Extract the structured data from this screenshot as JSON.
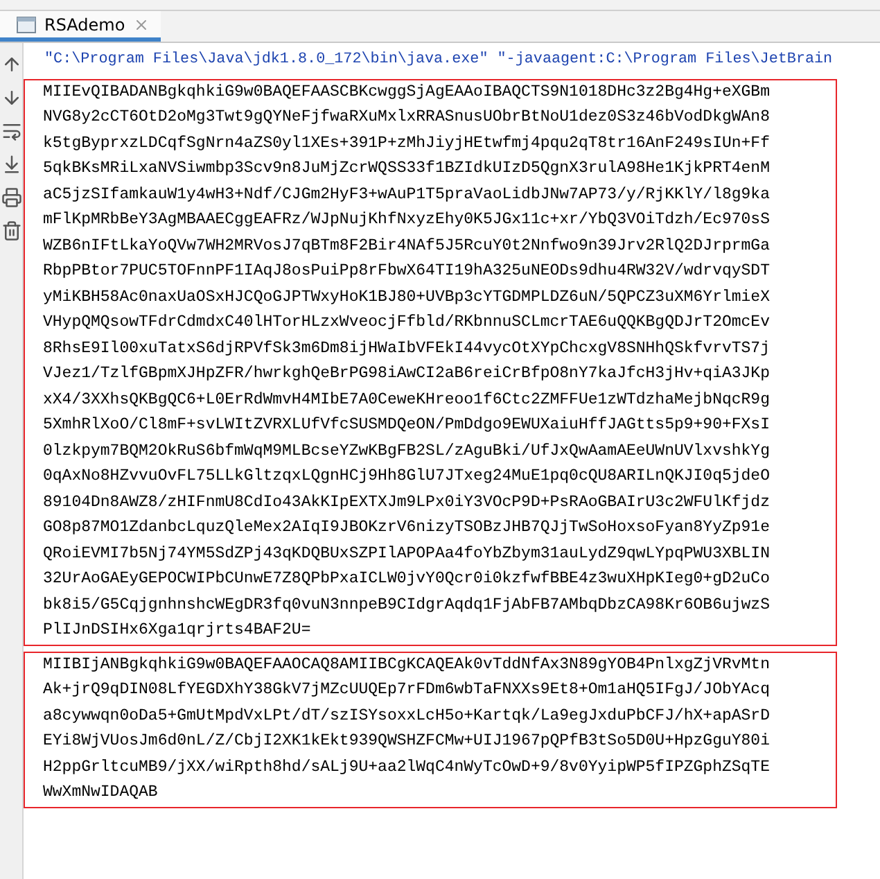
{
  "run_tab": {
    "title": "RSAdemo",
    "selected": true
  },
  "command_line": "\"C:\\Program Files\\Java\\jdk1.8.0_172\\bin\\java.exe\" \"-javaagent:C:\\Program Files\\JetBrain",
  "output_blocks": [
    {
      "lines": [
        "MIIEvQIBADANBgkqhkiG9w0BAQEFAASCBKcwggSjAgEAAoIBAQCTS9N1018DHc3z2Bg4Hg+eXGBm",
        "NVG8y2cCT6OtD2oMg3Twt9gQYNeFjfwaRXuMxlxRRASnusUObrBtNoU1dez0S3z46bVodDkgWAn8",
        "k5tgByprxzLDCqfSgNrn4aZS0yl1XEs+391P+zMhJiyjHEtwfmj4pqu2qT8tr16AnF249sIUn+Ff",
        "5qkBKsMRiLxaNVSiwmbp3Scv9n8JuMjZcrWQSS33f1BZIdkUIzD5QgnX3rulA98He1KjkPRT4enM",
        "aC5jzSIfamkauW1y4wH3+Ndf/CJGm2HyF3+wAuP1T5praVaoLidbJNw7AP73/y/RjKKlY/l8g9ka",
        "mFlKpMRbBeY3AgMBAAECggEAFRz/WJpNujKhfNxyzEhy0K5JGx11c+xr/YbQ3VOiTdzh/Ec970sS",
        "WZB6nIFtLkaYoQVw7WH2MRVosJ7qBTm8F2Bir4NAf5J5RcuY0t2Nnfwo9n39Jrv2RlQ2DJrprmGa",
        "RbpPBtor7PUC5TOFnnPF1IAqJ8osPuiPp8rFbwX64TI19hA325uNEODs9dhu4RW32V/wdrvqySDT",
        "yMiKBH58Ac0naxUaOSxHJCQoGJPTWxyHoK1BJ80+UVBp3cYTGDMPLDZ6uN/5QPCZ3uXM6YrlmieX",
        "VHypQMQsowTFdrCdmdxC40lHTorHLzxWveocjFfbld/RKbnnuSCLmcrTAE6uQQKBgQDJrT2OmcEv",
        "8RhsE9Il00xuTatxS6djRPVfSk3m6Dm8ijHWaIbVFEkI44vycOtXYpChcxgV8SNHhQSkfvrvTS7j",
        "VJez1/TzlfGBpmXJHpZFR/hwrkghQeBrPG98iAwCI2aB6reiCrBfpO8nY7kaJfcH3jHv+qiA3JKp",
        "xX4/3XXhsQKBgQC6+L0ErRdWmvH4MIbE7A0CeweKHreoo1f6Ctc2ZMFFUe1zWTdzhaMejbNqcR9g",
        "5XmhRlXoO/Cl8mF+svLWItZVRXLUfVfcSUSMDQeON/PmDdgo9EWUXaiuHffJAGtts5p9+90+FXsI",
        "0lzkpym7BQM2OkRuS6bfmWqM9MLBcseYZwKBgFB2SL/zAguBki/UfJxQwAamAEeUWnUVlxvshkYg",
        "0qAxNo8HZvvuOvFL75LLkGltzqxLQgnHCj9Hh8GlU7JTxeg24MuE1pq0cQU8ARILnQKJI0q5jdeO",
        "89104Dn8AWZ8/zHIFnmU8CdIo43AkKIpEXTXJm9LPx0iY3VOcP9D+PsRAoGBAIrU3c2WFUlKfjdz",
        "GO8p87MO1ZdanbcLquzQleMex2AIqI9JBOKzrV6nizyTSOBzJHB7QJjTwSoHoxsoFyan8YyZp91e",
        "QRoiEVMI7b5Nj74YM5SdZPj43qKDQBUxSZPIlAPOPAa4foYbZbym31auLydZ9qwLYpqPWU3XBLIN",
        "32UrAoGAEyGEPOCWIPbCUnwE7Z8QPbPxaICLW0jvY0Qcr0i0kzfwfBBE4z3wuXHpKIeg0+gD2uCo",
        "bk8i5/G5CqjgnhnshcWEgDR3fq0vuN3nnpeB9CIdgrAqdq1FjAbFB7AMbqDbzCA98Kr6OB6ujwzS",
        "PlIJnDSIHx6Xga1qrjrts4BAF2U="
      ]
    },
    {
      "lines": [
        "MIIBIjANBgkqhkiG9w0BAQEFAAOCAQ8AMIIBCgKCAQEAk0vTddNfAx3N89gYOB4PnlxgZjVRvMtn",
        "Ak+jrQ9qDIN08LfYEGDXhY38GkV7jMZcUUQEp7rFDm6wbTaFNXXs9Et8+Om1aHQ5IFgJ/JObYAcq",
        "a8cywwqn0oDa5+GmUtMpdVxLPt/dT/szISYsoxxLcH5o+Kartqk/La9egJxduPbCFJ/hX+apASrD",
        "EYi8WjVUosJm6d0nL/Z/CbjI2XK1kEkt939QWSHZFCMw+UIJ1967pQPfB3tSo5D0U+HpzGguY80i",
        "H2ppGrltcuMB9/jXX/wiRpth8hd/sALj9U+aa2lWqC4nWyTcOwD+9/8v0YyipWP5fIPZGphZSqTE",
        "WwXmNwIDAQAB"
      ]
    }
  ]
}
